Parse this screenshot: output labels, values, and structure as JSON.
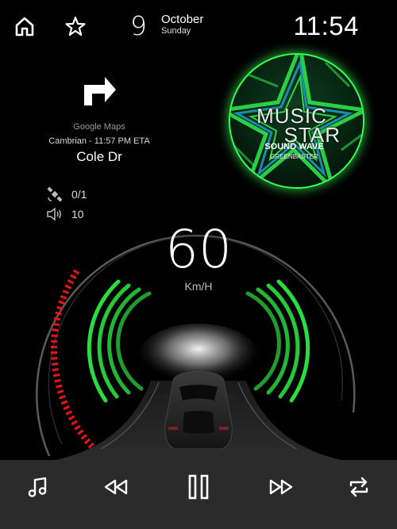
{
  "header": {
    "home_icon": "home-icon",
    "favorite_icon": "star-icon",
    "day": "9",
    "month": "October",
    "weekday": "Sunday",
    "time": "11:54"
  },
  "navigation": {
    "turn_icon": "turn-right-arrow-icon",
    "source": "Google Maps",
    "eta": "Cambrian - 11:57 PM ETA",
    "street": "Cole Dr"
  },
  "now_playing": {
    "album_line1": "MUSIC",
    "album_line2": "STAR",
    "song": "SOUND WAVE",
    "artist": "GREENBASTER",
    "accent": "#33ff55"
  },
  "status": {
    "satellites": "0/1",
    "volume": "10",
    "satellite_icon": "satellite-icon",
    "volume_icon": "volume-icon"
  },
  "speedometer": {
    "speed": "60",
    "unit": "Km/H",
    "level_fraction": 0.32,
    "gauge_color": "#e0141a"
  },
  "controls": {
    "icons": [
      "music-note-icon",
      "rewind-icon",
      "pause-icon",
      "fast-forward-icon",
      "repeat-icon"
    ]
  }
}
